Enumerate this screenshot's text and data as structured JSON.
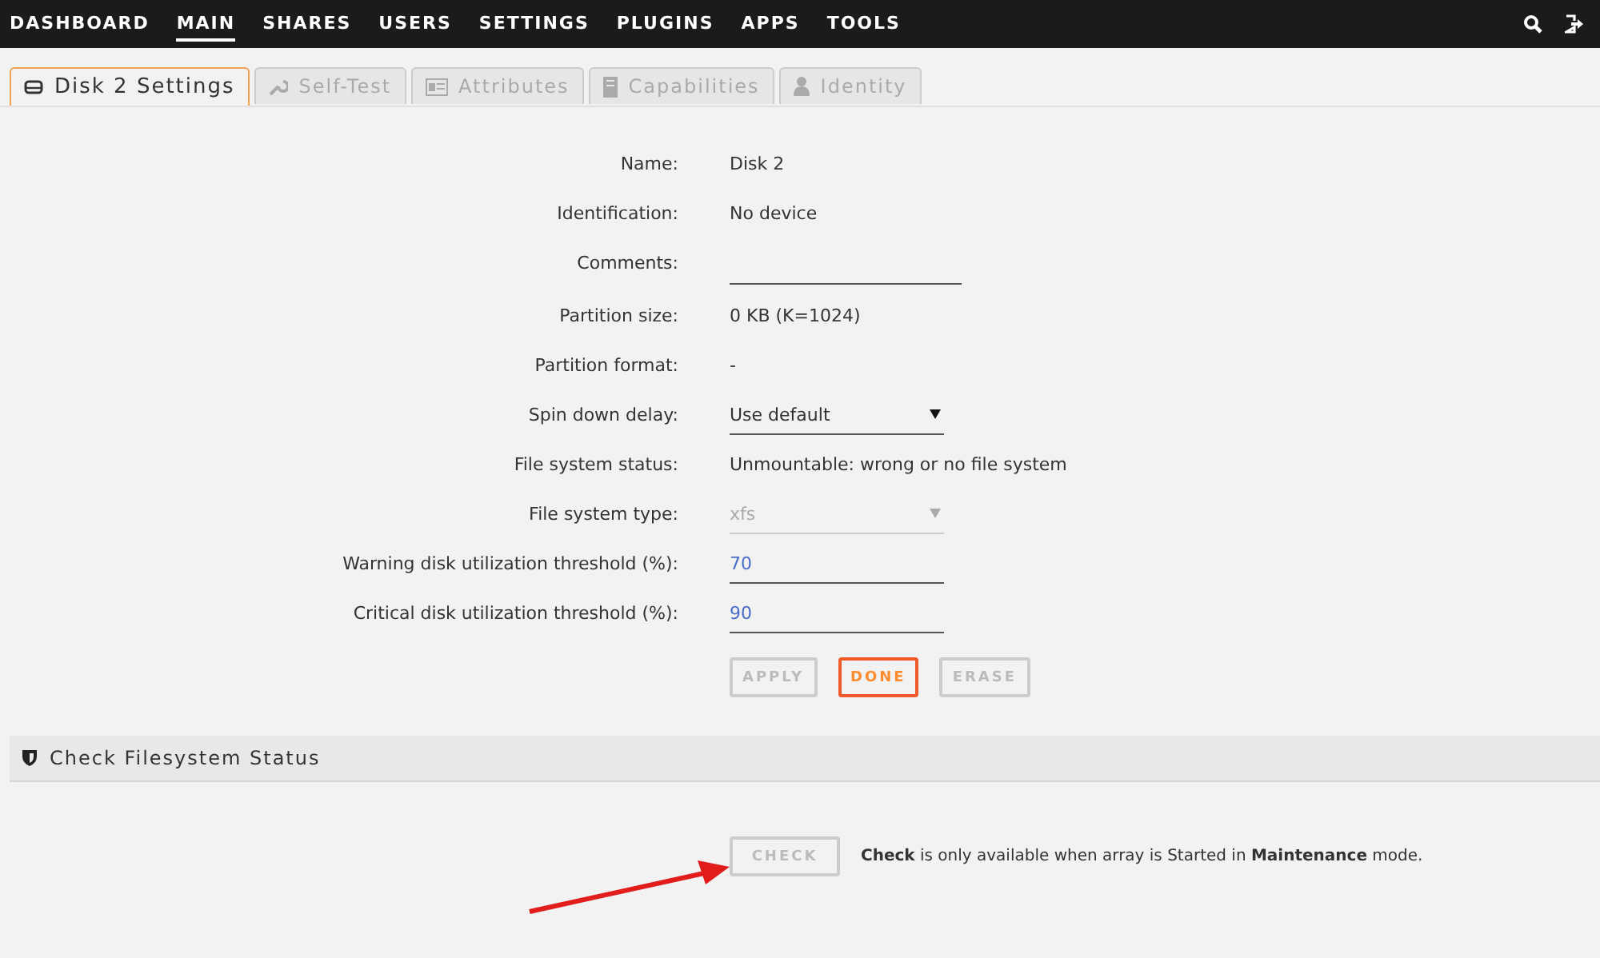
{
  "nav": {
    "items": [
      {
        "label": "DASHBOARD",
        "selected": false
      },
      {
        "label": "MAIN",
        "selected": true
      },
      {
        "label": "SHARES",
        "selected": false
      },
      {
        "label": "USERS",
        "selected": false
      },
      {
        "label": "SETTINGS",
        "selected": false
      },
      {
        "label": "PLUGINS",
        "selected": false
      },
      {
        "label": "APPS",
        "selected": false
      },
      {
        "label": "TOOLS",
        "selected": false
      }
    ]
  },
  "tabs": [
    {
      "label": "Disk 2 Settings",
      "kind": "drive",
      "selected": true
    },
    {
      "label": "Self-Test",
      "kind": "wrench",
      "selected": false
    },
    {
      "label": "Attributes",
      "kind": "card",
      "selected": false
    },
    {
      "label": "Capabilities",
      "kind": "server",
      "selected": false
    },
    {
      "label": "Identity",
      "kind": "user",
      "selected": false
    }
  ],
  "form": {
    "rows": [
      {
        "kind": "text",
        "label": "Name:",
        "value": "Disk 2"
      },
      {
        "kind": "text",
        "label": "Identification:",
        "value": "No device"
      },
      {
        "kind": "input",
        "label": "Comments:",
        "wide": true
      },
      {
        "kind": "text",
        "label": "Partition size:",
        "value": "0 KB (K=1024)"
      },
      {
        "kind": "text",
        "label": "Partition format:",
        "value": "-"
      },
      {
        "kind": "select",
        "label": "Spin down delay:",
        "value": "Use default",
        "disabled": false
      },
      {
        "kind": "text",
        "label": "File system status:",
        "value": "Unmountable: wrong or no file system"
      },
      {
        "kind": "select",
        "label": "File system type:",
        "value": "xfs",
        "disabled": true
      },
      {
        "kind": "input",
        "label": "Warning disk utilization threshold (%):",
        "value": "70",
        "wide": false
      },
      {
        "kind": "input",
        "label": "Critical disk utilization threshold (%):",
        "value": "90",
        "wide": false
      }
    ],
    "buttons": [
      {
        "label": "APPLY",
        "disabled": true
      },
      {
        "label": "DONE",
        "disabled": false
      },
      {
        "label": "ERASE",
        "disabled": true
      }
    ]
  },
  "check_section": {
    "title": "Check Filesystem Status",
    "button": {
      "label": "CHECK",
      "disabled": true
    },
    "note": "**Check** is only available when array is Started in **Maintenance** mode."
  }
}
